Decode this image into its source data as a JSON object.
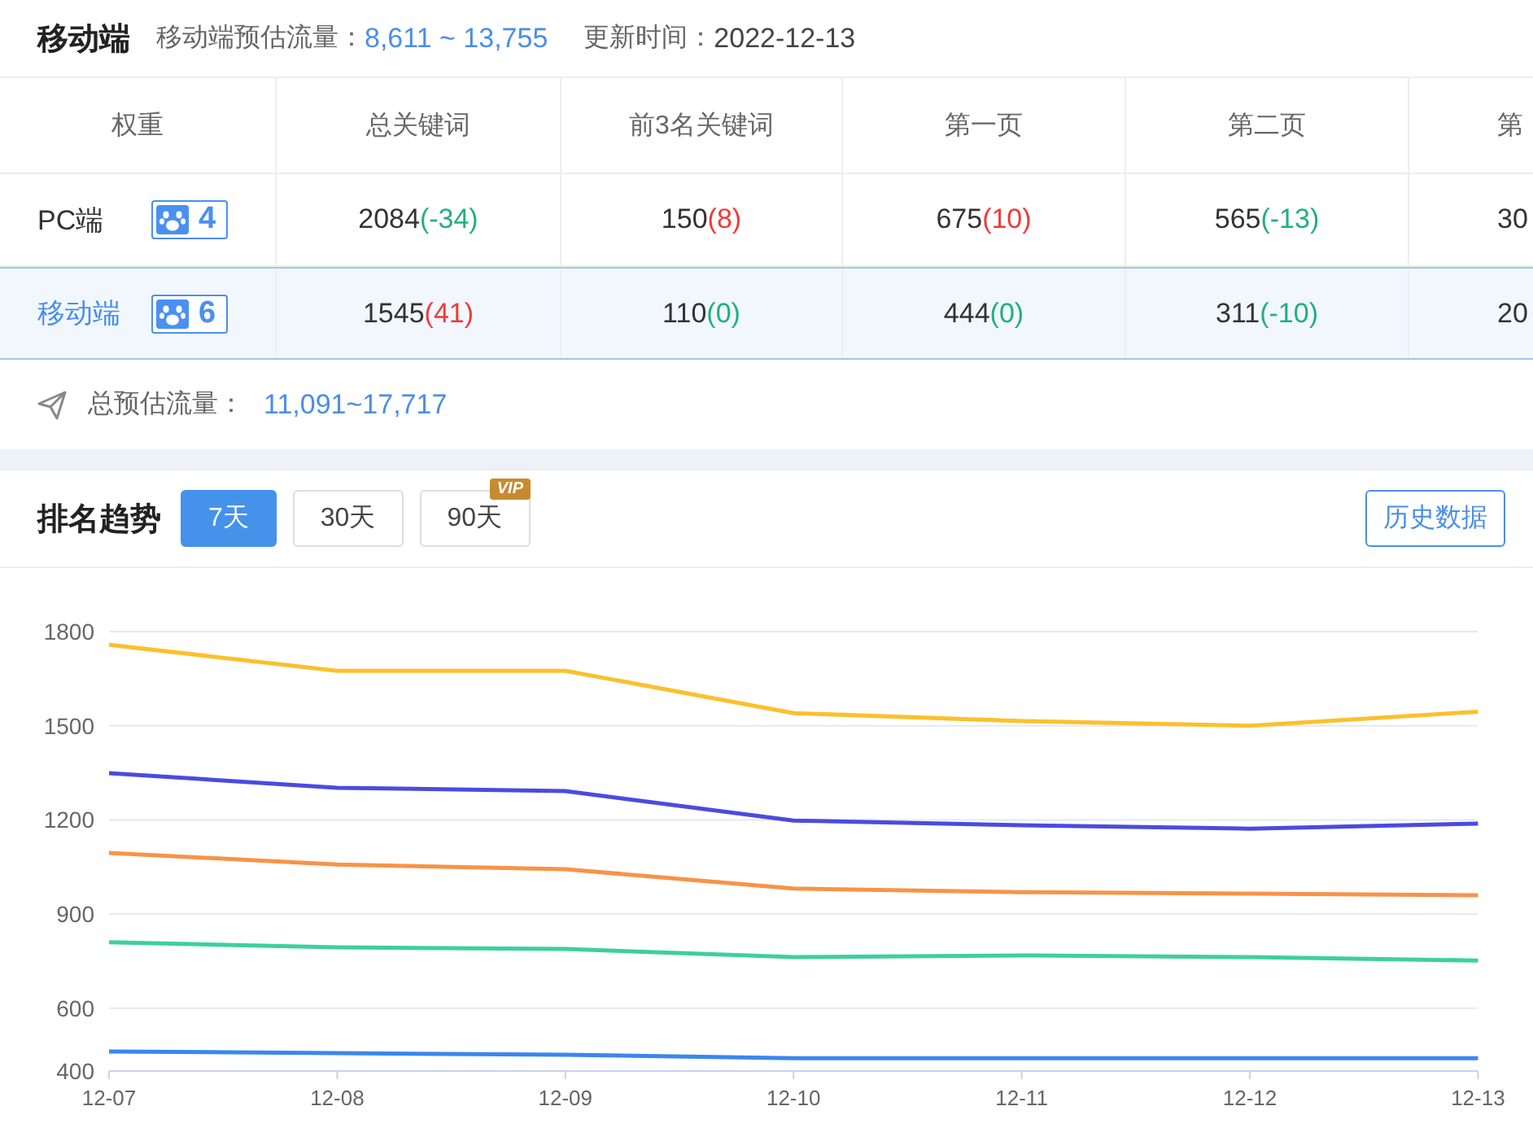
{
  "header": {
    "title": "移动端",
    "traffic_label": "移动端预估流量：",
    "traffic_value": "8,611 ~ 13,755",
    "update_label": "更新时间：",
    "update_value": "2022-12-13"
  },
  "table": {
    "columns": [
      "权重",
      "总关键词",
      "前3名关键词",
      "第一页",
      "第二页",
      "第"
    ],
    "rows": [
      {
        "selected": false,
        "cells": [
          {
            "kind": "platform",
            "text": "PC端",
            "rank": "4"
          },
          {
            "kind": "count",
            "value": "2084",
            "change": "(-34)",
            "color": "#22b07d"
          },
          {
            "kind": "count",
            "value": "150",
            "change": "(8)",
            "color": "#f03a3a"
          },
          {
            "kind": "count",
            "value": "675",
            "change": "(10)",
            "color": "#f03a3a"
          },
          {
            "kind": "count",
            "value": "565",
            "change": "(-13)",
            "color": "#22b07d"
          },
          {
            "kind": "count",
            "value": "30"
          }
        ]
      },
      {
        "selected": true,
        "cells": [
          {
            "kind": "platform",
            "text": "移动端",
            "rank": "6"
          },
          {
            "kind": "count",
            "value": "1545",
            "change": "(41)",
            "color": "#f03a3a"
          },
          {
            "kind": "count",
            "value": "110",
            "change": "(0)",
            "color": "#22b07d"
          },
          {
            "kind": "count",
            "value": "444",
            "change": "(0)",
            "color": "#22b07d"
          },
          {
            "kind": "count",
            "value": "311",
            "change": "(-10)",
            "color": "#22b07d"
          },
          {
            "kind": "count",
            "value": "20"
          }
        ]
      }
    ]
  },
  "total": {
    "label": "总预估流量：",
    "value": "11,091~17,717"
  },
  "trend": {
    "title": "排名趋势",
    "tabs": [
      {
        "label": "7天",
        "selected": true
      },
      {
        "label": "30天",
        "selected": false
      },
      {
        "label": "90天",
        "selected": false,
        "badge": "VIP"
      }
    ],
    "history_button": "历史数据",
    "chart_data": {
      "type": "line",
      "grid": true,
      "categories": [
        "12-07",
        "12-08",
        "12-09",
        "12-10",
        "12-11",
        "12-12",
        "12-13"
      ],
      "ylim": [
        400,
        1800
      ],
      "yticks": [
        400,
        600,
        900,
        1200,
        1500,
        1800
      ],
      "series": [
        {
          "color": "#fbc02d",
          "values": [
            1758,
            1675,
            1675,
            1540,
            1515,
            1500,
            1545
          ]
        },
        {
          "color": "#4b4be0",
          "values": [
            1349,
            1302,
            1292,
            1198,
            1183,
            1172,
            1188
          ]
        },
        {
          "color": "#f89348",
          "values": [
            1095,
            1058,
            1043,
            981,
            970,
            965,
            960
          ]
        },
        {
          "color": "#3ecf9e",
          "values": [
            810,
            794,
            789,
            763,
            768,
            763,
            752
          ]
        },
        {
          "color": "#3a86f0",
          "values": [
            462,
            457,
            452,
            441,
            441,
            441,
            441
          ]
        }
      ]
    }
  }
}
